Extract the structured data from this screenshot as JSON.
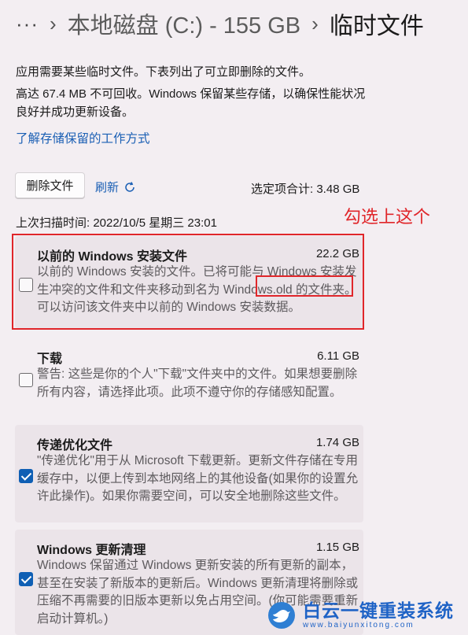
{
  "breadcrumb": {
    "overflow": "···",
    "separator": "›",
    "drive": "本地磁盘 (C:) - 155 GB",
    "current": "临时文件"
  },
  "intro": {
    "line1": "应用需要某些临时文件。下表列出了可立即删除的文件。",
    "line2": "高达 67.4 MB 不可回收。Windows 保留某些存储，以确保性能状况良好并成功更新设备。",
    "link": "了解存储保留的工作方式"
  },
  "toolbar": {
    "delete_label": "删除文件",
    "refresh_label": "刷新",
    "total": "选定项合计: 3.48 GB",
    "last_scan": "上次扫描时间: 2022/10/5 星期三 23:01"
  },
  "annotation": "勾选上这个",
  "items": [
    {
      "title": "以前的 Windows 安装文件",
      "size": "22.2 GB",
      "text": "以前的 Windows 安装的文件。已将可能与 Windows 安装发生冲突的文件和文件夹移动到名为 Windows.old 的文件夹。可以访问该文件夹中以前的 Windows 安装数据。",
      "checked": false
    },
    {
      "title": "下载",
      "size": "6.11 GB",
      "text": "警告: 这些是你的个人\"下载\"文件夹中的文件。如果想要删除所有内容，请选择此项。此项不遵守你的存储感知配置。",
      "checked": false
    },
    {
      "title": "传递优化文件",
      "size": "1.74 GB",
      "text": "\"传递优化\"用于从 Microsoft 下载更新。更新文件存储在专用缓存中，以便上传到本地网络上的其他设备(如果你的设置允许此操作)。如果你需要空间，可以安全地删除这些文件。",
      "checked": true
    },
    {
      "title": "Windows 更新清理",
      "size": "1.15 GB",
      "text": "Windows 保留通过 Windows 更新安装的所有更新的副本，甚至在安装了新版本的更新后。Windows 更新清理将删除或压缩不再需要的旧版本更新以免占用空间。(你可能需要重新启动计算机。)",
      "checked": true
    }
  ],
  "watermark": {
    "title": "白云一键重装系统",
    "url": "www.baiyunxitong.com"
  },
  "colors": {
    "accent": "#0f5fb4",
    "link": "#1a5fb4",
    "annotation_red": "#e0262a",
    "background": "#f3eef2",
    "card": "#ebe4e9"
  }
}
